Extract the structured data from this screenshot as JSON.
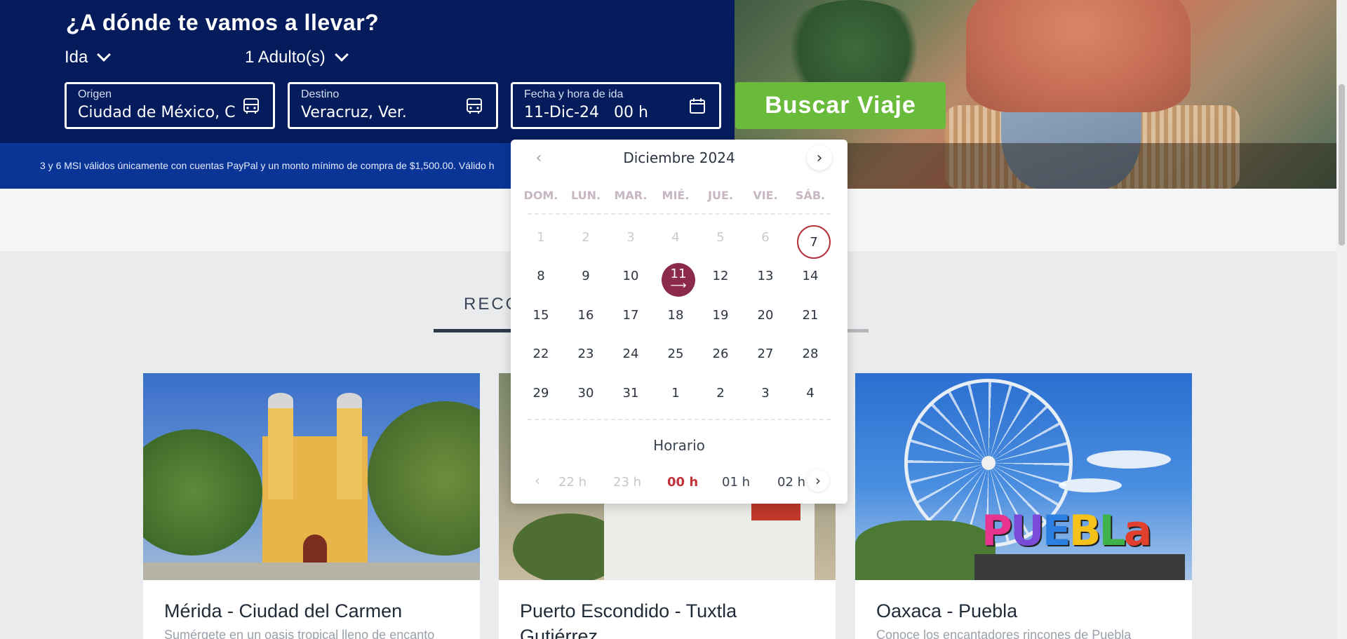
{
  "header": {
    "title": "¿A dónde te vamos a llevar?",
    "trip_type": "Ida",
    "passengers": "1 Adulto(s)"
  },
  "search": {
    "origin_label": "Origen",
    "origin_value": "Ciudad de México, CDMX",
    "destination_label": "Destino",
    "destination_value": "Veracruz, Ver.",
    "date_label": "Fecha y hora de ida",
    "date_value": "11-Dic-24",
    "hour_value": "00 h",
    "button_label": "Buscar Viaje"
  },
  "promo": {
    "text": "3 y 6 MSI válidos únicamente con cuentas PayPal y un monto mínimo de compra de $1,500.00. Válido h"
  },
  "calendar": {
    "month_label": "Diciembre 2024",
    "weekdays": [
      "DOM.",
      "LUN.",
      "MAR.",
      "MIÉ.",
      "JUE.",
      "VIE.",
      "SÁB."
    ],
    "weeks": [
      [
        "1",
        "2",
        "3",
        "4",
        "5",
        "6",
        "7"
      ],
      [
        "8",
        "9",
        "10",
        "11",
        "12",
        "13",
        "14"
      ],
      [
        "15",
        "16",
        "17",
        "18",
        "19",
        "20",
        "21"
      ],
      [
        "22",
        "23",
        "24",
        "25",
        "26",
        "27",
        "28"
      ],
      [
        "29",
        "30",
        "31",
        "1",
        "2",
        "3",
        "4"
      ]
    ],
    "selected_arrow": "⟶",
    "schedule_label": "Horario",
    "hours": [
      "22 h",
      "23 h",
      "00 h",
      "01 h",
      "02 h"
    ],
    "prev_icon": "‹",
    "next_icon": "›"
  },
  "recommended": {
    "tab_label": "RECO"
  },
  "cards": [
    {
      "title": "Mérida - Ciudad del Carmen",
      "description": "Sumérgete en un oasis tropical lleno de encanto"
    },
    {
      "title": "Puerto Escondido - Tuxtla Gutiérrez",
      "description": ""
    },
    {
      "title": "Oaxaca - Puebla",
      "description": "Conoce los encantadores rincones de Puebla"
    }
  ],
  "puebla_sign": [
    "P",
    "U",
    "E",
    "B",
    "L",
    "a"
  ],
  "colors": {
    "navy": "#041c5c",
    "promo_blue": "#0a3596",
    "search_green": "#6abb3c",
    "selected_day": "#8b2a4c",
    "active_hour": "#c0333b"
  }
}
